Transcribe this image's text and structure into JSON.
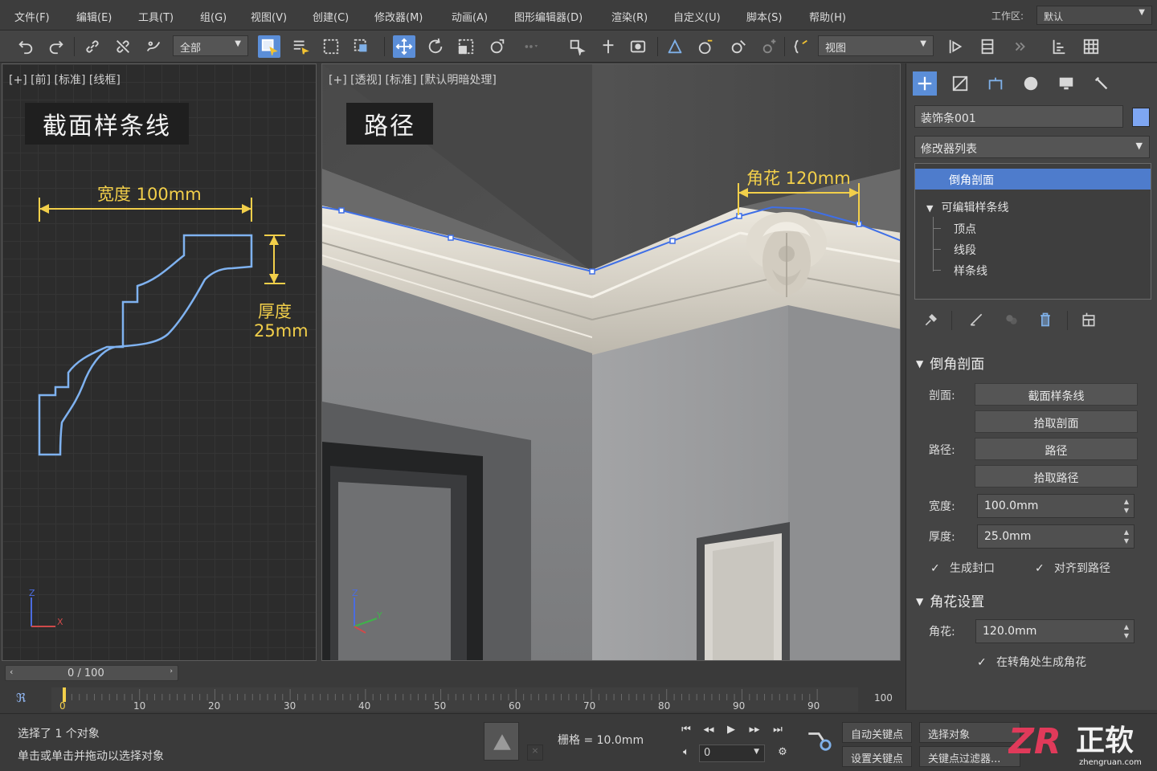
{
  "menu": [
    "文件(F)",
    "编辑(E)",
    "工具(T)",
    "组(G)",
    "视图(V)",
    "创建(C)",
    "修改器(M)",
    "动画(A)",
    "图形编辑器(D)",
    "渲染(R)",
    "自定义(U)",
    "脚本(S)",
    "帮助(H)"
  ],
  "workspace": {
    "label": "工作区:",
    "value": "默认"
  },
  "toolbar": {
    "selection_filter": "全部",
    "ref_coord": "视图"
  },
  "viewports": {
    "front": {
      "label": "[+] [前] [标准] [线框]",
      "title": "截面样条线",
      "width_anno": "宽度 100mm",
      "thickness_anno_line1": "厚度",
      "thickness_anno_line2": "25mm"
    },
    "perspective": {
      "label": "[+] [透视] [标准] [默认明暗处理]",
      "title": "路径",
      "corner_anno": "角花 120mm"
    }
  },
  "command_panel": {
    "object_name": "装饰条001",
    "object_color": "#7ea6f2",
    "modifier_list": "修改器列表",
    "stack": {
      "top_modifier": "倒角剖面",
      "base_object": "可编辑样条线",
      "sub_objects": [
        "顶点",
        "线段",
        "样条线"
      ]
    },
    "rollout_bevel": {
      "title": "倒角剖面",
      "profile_label": "剖面:",
      "profile_value": "截面样条线",
      "pick_profile": "拾取剖面",
      "path_label": "路径:",
      "path_value": "路径",
      "pick_path": "拾取路径",
      "width_label": "宽度:",
      "width_value": "100.0mm",
      "thickness_label": "厚度:",
      "thickness_value": "25.0mm",
      "cap_label": "生成封口",
      "cap_checked": true,
      "align_label": "对齐到路径",
      "align_checked": true
    },
    "rollout_corner": {
      "title": "角花设置",
      "corner_label": "角花:",
      "corner_value": "120.0mm",
      "gen_label": "在转角处生成角花",
      "gen_checked": true
    }
  },
  "timeline": {
    "slider": "0 / 100",
    "ticks": [
      "0",
      "10",
      "20",
      "30",
      "40",
      "50",
      "60",
      "70",
      "80",
      "90",
      "90",
      "100"
    ]
  },
  "status": {
    "line1": "选择了 1 个对象",
    "line2": "单击或单击并拖动以选择对象",
    "grid": "栅格 = 10.0mm",
    "auto_key": "自动关键点",
    "set_key": "设置关键点",
    "select_object": "选择对象",
    "key_filter": "关键点过滤器...",
    "frame": "0"
  },
  "watermark": {
    "text": "正软",
    "url": "zhengruan.com"
  }
}
